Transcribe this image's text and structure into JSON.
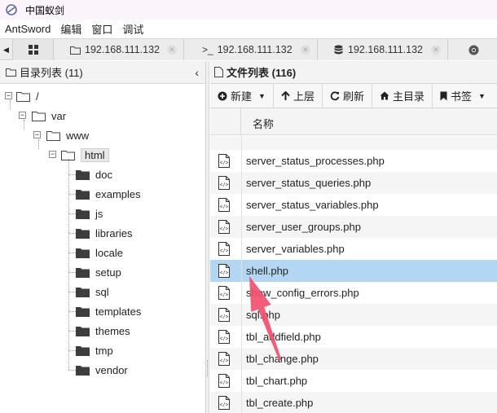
{
  "window": {
    "title": "中国蚁剑"
  },
  "menu": [
    "AntSword",
    "编辑",
    "窗口",
    "调试"
  ],
  "tabs": [
    {
      "icon": "folder-icon",
      "label": "192.168.111.132"
    },
    {
      "icon": "terminal-icon",
      "label": "192.168.111.132"
    },
    {
      "icon": "database-icon",
      "label": "192.168.111.132"
    },
    {
      "icon": "chrome-icon",
      "label": ""
    }
  ],
  "terminal_prefix": ">_",
  "left_panel": {
    "title": "目录列表 (11)",
    "tree": {
      "root": "/",
      "var": "var",
      "www": "www",
      "html": "html",
      "children": [
        "doc",
        "examples",
        "js",
        "libraries",
        "locale",
        "setup",
        "sql",
        "templates",
        "themes",
        "tmp",
        "vendor"
      ]
    }
  },
  "right_panel": {
    "title": "文件列表 (116)",
    "toolbar": {
      "new": "新建",
      "up": "上层",
      "refresh": "刷新",
      "home": "主目录",
      "bookmark": "书签"
    },
    "column_name": "名称",
    "files": [
      "server_status_processes.php",
      "server_status_queries.php",
      "server_status_variables.php",
      "server_user_groups.php",
      "server_variables.php",
      "shell.php",
      "show_config_errors.php",
      "sql.php",
      "tbl_addfield.php",
      "tbl_change.php",
      "tbl_chart.php",
      "tbl_create.php"
    ],
    "selected_file": "shell.php"
  },
  "colors": {
    "selected_row": "#b3d7f3",
    "annotation_arrow": "#f0506e"
  }
}
